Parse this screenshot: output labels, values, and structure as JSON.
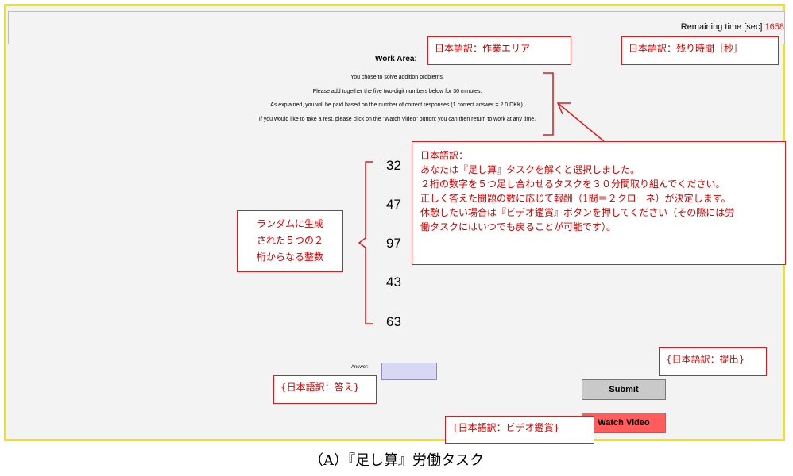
{
  "header": {
    "remaining_label": "Remaining time [sec]:",
    "remaining_value": "1658"
  },
  "work_area": {
    "title": "Work Area:",
    "instructions": [
      "You chose to solve addition problems.",
      "Please add together the five two-digit numbers below for 30 minutes.",
      "As explained, you will be paid based on the number of correct responses (1 correct answer = 2.0 DKK).",
      "If you would like to take a rest, please click on the \"Watch Video\" button; you can then return to work at any time."
    ],
    "numbers": [
      "32",
      "47",
      "97",
      "43",
      "63"
    ]
  },
  "answer": {
    "label": "Answer:",
    "value": ""
  },
  "buttons": {
    "submit": "Submit",
    "watch_video": "Watch Video"
  },
  "annotations": {
    "work_area": "日本語訳：作業エリア",
    "remaining_time": "日本語訳：残り時間［秒］",
    "instructions_lines": [
      "日本語訳：",
      "あなたは『足し算』タスクを解くと選択しました。",
      "２桁の数字を５つ足し合わせるタスクを３０分間取り組んでください。",
      "正しく答えた問題の数に応じて報酬（1問＝２クローネ）が決定します。",
      "休憩したい場合は『ビデオ鑑賞』ボタンを押してください（その際には労",
      "働タスクにはいつでも戻ることが可能です）。"
    ],
    "numbers_lines": [
      "ランダムに生成",
      "された５つの２",
      "桁からなる整数"
    ],
    "answer": "{日本語訳：答え}",
    "submit": "{日本語訳：提出}",
    "watch_video": "{日本語訳：ビデオ鑑賞}"
  },
  "caption": "（A）『足し算』労働タスク",
  "colors": {
    "frame_border": "#f2e600",
    "annotation": "#e01b1b",
    "watch_button": "#ff5c5c",
    "answer_bg": "#d8d8f5"
  }
}
